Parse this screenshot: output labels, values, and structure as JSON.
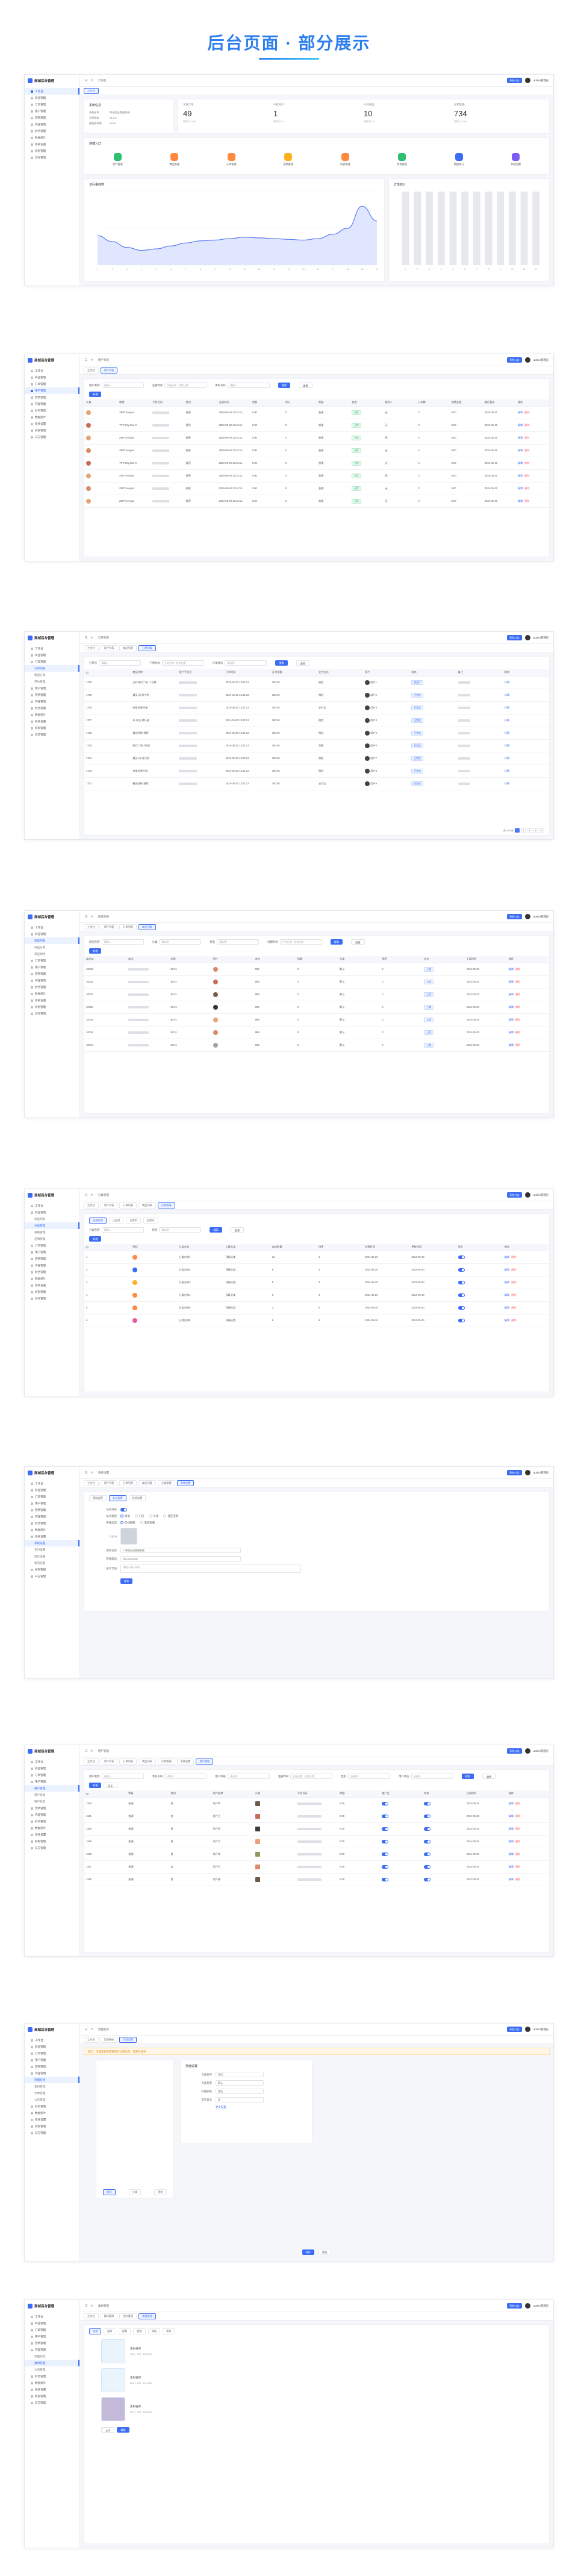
{
  "page": {
    "title": "后台页面 · 部分展示"
  },
  "app": {
    "name": "商城后台管理",
    "user": "admin管理员",
    "top_button": "系统公告"
  },
  "menu_main": [
    "工作台",
    "商品管理",
    "订单管理",
    "用户管理",
    "营销管理",
    "内容管理",
    "财务管理",
    "数据统计",
    "系统设置",
    "权限管理",
    "日志管理"
  ],
  "s1": {
    "crumb": "工作台",
    "tabs": [
      "工作台"
    ],
    "welcome_title": "系统信息",
    "info": [
      [
        "系统名称",
        "商城后台管理系统"
      ],
      [
        "当前版本",
        "v1.0.0"
      ],
      [
        "服务器系统",
        "Linux"
      ]
    ],
    "stats": [
      {
        "title": "今日订单",
        "value": "49",
        "sub": "较昨日 +8%"
      },
      {
        "title": "今日用户",
        "value": "1",
        "sub": "较昨日 +1"
      },
      {
        "title": "今日商品",
        "value": "10",
        "sub": "较昨日 +2"
      },
      {
        "title": "总销售额",
        "value": "734",
        "sub": "较昨日 +5%"
      }
    ],
    "quick_title": "快捷入口",
    "quick": [
      {
        "label": "用户管理",
        "color": "#2fbf71"
      },
      {
        "label": "商品管理",
        "color": "#ff8a3d"
      },
      {
        "label": "订单管理",
        "color": "#ff8a3d"
      },
      {
        "label": "营销管理",
        "color": "#ffb020"
      },
      {
        "label": "内容管理",
        "color": "#ff8a3d"
      },
      {
        "label": "财务管理",
        "color": "#2fbf71"
      },
      {
        "label": "数据统计",
        "color": "#3b6cf6"
      },
      {
        "label": "系统设置",
        "color": "#7b5cf6"
      }
    ],
    "chart_left_title": "访问量趋势",
    "chart_right_title": "订单统计"
  },
  "chart_data": [
    {
      "type": "area",
      "title": "访问量趋势",
      "x": [
        "1",
        "2",
        "3",
        "4",
        "5",
        "6",
        "7",
        "8",
        "9",
        "10",
        "11",
        "12",
        "13",
        "14",
        "15",
        "16",
        "17",
        "18",
        "19",
        "20"
      ],
      "series": [
        {
          "values": [
            40,
            32,
            24,
            20,
            22,
            26,
            30,
            33,
            34,
            36,
            38,
            37,
            36,
            35,
            34,
            36,
            42,
            50,
            80,
            60
          ]
        }
      ],
      "ylim": [
        0,
        100
      ],
      "color": "#5b7cf6"
    },
    {
      "type": "bar",
      "title": "订单统计",
      "categories": [
        "1",
        "2",
        "3",
        "4",
        "5",
        "6",
        "7",
        "8",
        "9",
        "10",
        "11",
        "12"
      ],
      "values": [
        100,
        100,
        100,
        100,
        100,
        100,
        100,
        100,
        100,
        100,
        100,
        100
      ],
      "ylim": [
        0,
        100
      ],
      "color": "#e6e8ec"
    }
  ],
  "s2": {
    "crumb": "用户列表",
    "tabs": [
      "工作台",
      "用户列表"
    ],
    "filters": [
      [
        "用户昵称",
        "请输入"
      ],
      [
        "注册时间",
        "开始日期 - 结束日期"
      ],
      [
        "手机号码",
        "请输入"
      ]
    ],
    "search": "搜索",
    "reset": "重置",
    "add": "新增",
    "columns": [
      "头像",
      "昵称",
      "手机号码",
      "性别",
      "注册时间",
      "余额",
      "积分",
      "等级",
      "状态",
      "推荐人",
      "订单数",
      "消费金额",
      "最后登录",
      "操作"
    ],
    "rows": [
      {
        "nick": "ZBPTAeeyaa",
        "sex": "保密",
        "time": "2024-05-20 13:42:12",
        "balance": "0.00",
        "points": "0",
        "level": "普通",
        "status": "正常",
        "ref": "无",
        "orders": "0",
        "spend": "0.00",
        "last": "2024-05-20",
        "av": "#e8a27a"
      },
      {
        "nick": "TP·Party.Nan·0",
        "sex": "保密",
        "time": "2024-05-20 13:42:12",
        "balance": "0.00",
        "points": "0",
        "level": "普通",
        "status": "正常",
        "ref": "无",
        "orders": "0",
        "spend": "0.00",
        "last": "2024-05-20",
        "av": "#c96b5a"
      },
      {
        "nick": "ZBPTAeeyaa",
        "sex": "保密",
        "time": "2024-05-20 13:42:12",
        "balance": "0.00",
        "points": "0",
        "level": "普通",
        "status": "正常",
        "ref": "无",
        "orders": "0",
        "spend": "0.00",
        "last": "2024-05-20",
        "av": "#e8a27a"
      },
      {
        "nick": "ZBPTAeeyaa",
        "sex": "保密",
        "time": "2024-05-20 13:42:12",
        "balance": "0.00",
        "points": "0",
        "level": "普通",
        "status": "正常",
        "ref": "无",
        "orders": "0",
        "spend": "0.00",
        "last": "2024-05-20",
        "av": "#d98c6a"
      },
      {
        "nick": "TP·Party.Nan·0",
        "sex": "保密",
        "time": "2024-05-20 13:42:12",
        "balance": "0.00",
        "points": "0",
        "level": "普通",
        "status": "正常",
        "ref": "无",
        "orders": "0",
        "spend": "0.00",
        "last": "2024-05-20",
        "av": "#c96b5a"
      },
      {
        "nick": "ZBPTAeeyaa",
        "sex": "保密",
        "time": "2024-05-20 13:42:12",
        "balance": "0.00",
        "points": "0",
        "level": "普通",
        "status": "正常",
        "ref": "无",
        "orders": "0",
        "spend": "0.00",
        "last": "2024-05-20",
        "av": "#e8a27a"
      },
      {
        "nick": "ZBPTAeeyaa",
        "sex": "保密",
        "time": "2024-05-20 13:42:12",
        "balance": "0.00",
        "points": "0",
        "level": "普通",
        "status": "正常",
        "ref": "无",
        "orders": "0",
        "spend": "0.00",
        "last": "2024-05-20",
        "av": "#d98c6a"
      },
      {
        "nick": "ZBPTAeeyaa",
        "sex": "保密",
        "time": "2024-05-20 13:42:12",
        "balance": "0.00",
        "points": "0",
        "level": "普通",
        "status": "正常",
        "ref": "无",
        "orders": "0",
        "spend": "0.00",
        "last": "2024-05-20",
        "av": "#e8a27a"
      }
    ],
    "op_edit": "编辑",
    "op_del": "删除"
  },
  "s3": {
    "crumb": "订单列表",
    "tabs": [
      "工作台",
      "用户列表",
      "商品列表",
      "订单列表"
    ],
    "filters": [
      [
        "订单号",
        "请输入"
      ],
      [
        "下单时间",
        "开始日期 - 结束日期"
      ],
      [
        "订单状态",
        "请选择"
      ]
    ],
    "search": "搜索",
    "reset": "重置",
    "columns": [
      "ID",
      "商品名称",
      "用户手机号",
      "下单时间",
      "订单金额",
      "支付方式",
      "用户",
      "状态",
      "备注",
      "操作"
    ],
    "rows": [
      {
        "id": "1710",
        "name": "万科时代广场 · 2号楼",
        "time": "2024-05-20 13:42:12",
        "amount": "180.00",
        "pay": "微信",
        "user": "用户1",
        "status": "待支付"
      },
      {
        "id": "1709",
        "name": "遇见·风·时光的",
        "time": "2024-05-20 13:42:12",
        "amount": "180.00",
        "pay": "微信",
        "user": "用户2",
        "status": "已完成"
      },
      {
        "id": "1708",
        "name": "亲爱的旅行者",
        "time": "2024-05-20 13:42:12",
        "amount": "180.00",
        "pay": "支付宝",
        "user": "用户3",
        "status": "已完成"
      },
      {
        "id": "1707",
        "name": "风·时光·旅行者",
        "time": "2024-05-20 13:42:12",
        "amount": "180.00",
        "pay": "微信",
        "user": "用户4",
        "status": "已完成"
      },
      {
        "id": "1706",
        "name": "精选好物·推荐",
        "time": "2024-05-20 13:42:12",
        "amount": "180.00",
        "pay": "微信",
        "user": "用户5",
        "status": "已完成"
      },
      {
        "id": "1705",
        "name": "时代广场·3号楼",
        "time": "2024-05-20 13:42:12",
        "amount": "180.00",
        "pay": "余额",
        "user": "用户6",
        "status": "已完成"
      },
      {
        "id": "1704",
        "name": "遇见·风·时光的",
        "time": "2024-05-20 13:42:12",
        "amount": "180.00",
        "pay": "微信",
        "user": "用户7",
        "status": "已完成"
      },
      {
        "id": "1703",
        "name": "亲爱的旅行者",
        "time": "2024-05-20 13:42:12",
        "amount": "180.00",
        "pay": "微信",
        "user": "用户8",
        "status": "已完成"
      },
      {
        "id": "1702",
        "name": "精选好物·推荐",
        "time": "2024-05-20 13:42:12",
        "amount": "180.00",
        "pay": "支付宝",
        "user": "用户9",
        "status": "已完成"
      }
    ],
    "op": "详情",
    "total": "共 100 条",
    "pages": [
      "1",
      "2",
      "3",
      "4",
      "5"
    ]
  },
  "s4": {
    "crumb": "商品列表",
    "tabs": [
      "工作台",
      "用户列表",
      "订单列表",
      "商品列表"
    ],
    "filters": [
      [
        "商品名称",
        "请输入"
      ],
      [
        "分类",
        "请选择"
      ],
      [
        "状态",
        "请选择"
      ],
      [
        "创建时间",
        "开始日期 - 结束日期"
      ]
    ],
    "search": "搜索",
    "reset": "重置",
    "add": "新增",
    "columns": [
      "商品ID",
      "商品",
      "价格",
      "图片",
      "库存",
      "销量",
      "分类",
      "排序",
      "状态",
      "上架时间",
      "操作"
    ],
    "rows": [
      {
        "id": "10023",
        "price": "¥0.01",
        "stock": "999",
        "sales": "0",
        "cat": "默认",
        "sort": "0",
        "status": "上架",
        "time": "2024-05-20",
        "av": "#d98c6a"
      },
      {
        "id": "10022",
        "price": "¥0.01",
        "stock": "999",
        "sales": "0",
        "cat": "默认",
        "sort": "0",
        "status": "上架",
        "time": "2024-05-20",
        "av": "#c96b5a"
      },
      {
        "id": "10021",
        "price": "¥0.01",
        "stock": "999",
        "sales": "0",
        "cat": "默认",
        "sort": "0",
        "status": "上架",
        "time": "2024-05-20",
        "av": "#7a5a4a"
      },
      {
        "id": "10020",
        "price": "¥0.01",
        "stock": "999",
        "sales": "0",
        "cat": "默认",
        "sort": "0",
        "status": "上架",
        "time": "2024-05-20",
        "av": "#333333"
      },
      {
        "id": "10019",
        "price": "¥0.01",
        "stock": "999",
        "sales": "0",
        "cat": "默认",
        "sort": "0",
        "status": "上架",
        "time": "2024-05-20",
        "av": "#e8a27a"
      },
      {
        "id": "10018",
        "price": "¥0.01",
        "stock": "999",
        "sales": "0",
        "cat": "默认",
        "sort": "0",
        "status": "上架",
        "time": "2024-05-20",
        "av": "#d98c6a"
      },
      {
        "id": "10017",
        "price": "¥0.01",
        "stock": "999",
        "sales": "0",
        "cat": "默认",
        "sort": "0",
        "status": "上架",
        "time": "2024-05-20",
        "av": "#a0a4ad"
      }
    ],
    "op_edit": "编辑",
    "op_del": "删除"
  },
  "s5": {
    "crumb": "分类管理",
    "tabs": [
      "工作台",
      "用户列表",
      "订单列表",
      "商品列表",
      "分类管理"
    ],
    "subtabs": [
      "全部分类",
      "已启用",
      "已禁用",
      "回收站"
    ],
    "filters": [
      [
        "分类名称",
        "请输入"
      ],
      [
        "状态",
        "请选择"
      ]
    ],
    "search": "搜索",
    "reset": "重置",
    "add": "新增",
    "columns": [
      "ID",
      "图标",
      "分类名称",
      "上级分类",
      "商品数量",
      "排序",
      "创建时间",
      "更新时间",
      "显示",
      "操作"
    ],
    "rows": [
      {
        "id": "1",
        "name": "分类名称1",
        "parent": "顶级分类",
        "count": "12",
        "sort": "1",
        "time": "2024-05-20",
        "color": "#ff8a3d"
      },
      {
        "id": "2",
        "name": "分类名称2",
        "parent": "顶级分类",
        "count": "8",
        "sort": "2",
        "time": "2024-05-20",
        "color": "#3b6cf6"
      },
      {
        "id": "3",
        "name": "分类名称3",
        "parent": "顶级分类",
        "count": "5",
        "sort": "3",
        "time": "2024-05-20",
        "color": "#ffb020"
      },
      {
        "id": "4",
        "name": "分类名称4",
        "parent": "顶级分类",
        "count": "9",
        "sort": "4",
        "time": "2024-05-20",
        "color": "#ff8a3d"
      },
      {
        "id": "5",
        "name": "分类名称5",
        "parent": "顶级分类",
        "count": "3",
        "sort": "5",
        "time": "2024-05-20",
        "color": "#ff8a3d"
      },
      {
        "id": "6",
        "name": "分类名称6",
        "parent": "顶级分类",
        "count": "6",
        "sort": "6",
        "time": "2024-05-20",
        "color": "#e65aa0"
      }
    ],
    "op_edit": "编辑",
    "op_del": "删除"
  },
  "s6": {
    "crumb": "系统设置",
    "tabs": [
      "工作台",
      "用户列表",
      "订单列表",
      "商品列表",
      "分类管理",
      "系统设置"
    ],
    "subtabs": [
      "基础设置",
      "支付设置",
      "短信设置"
    ],
    "fields": [
      {
        "label": "站点开关",
        "type": "switch"
      },
      {
        "label": "站点类型",
        "type": "radio",
        "options": [
          "商城",
          "门店",
          "外卖",
          "社区团购"
        ]
      },
      {
        "label": "客服类型",
        "type": "radio",
        "options": [
          "在线客服",
          "电话客服"
        ]
      },
      {
        "label": "LOGO",
        "type": "image"
      },
      {
        "label": "版权信息",
        "type": "text",
        "value": "© 商城后台管理系统"
      },
      {
        "label": "客服电话",
        "type": "text",
        "value": "400-000-0000"
      },
      {
        "label": "统计代码",
        "type": "textarea",
        "value": "请输入统计代码"
      }
    ],
    "submit": "保存"
  },
  "s7": {
    "crumb": "用户管理",
    "tabs": [
      "工作台",
      "用户列表",
      "订单列表",
      "商品列表",
      "分类管理",
      "系统设置",
      "用户管理"
    ],
    "filters": [
      [
        "用户昵称",
        "请输入"
      ],
      [
        "手机号码",
        "请输入"
      ],
      [
        "用户等级",
        "请选择"
      ],
      [
        "注册时间",
        "开始日期 - 结束日期"
      ],
      [
        "性别",
        "请选择"
      ],
      [
        "用户状态",
        "请选择"
      ]
    ],
    "search": "搜索",
    "reset": "重置",
    "actions": [
      "新增",
      "导出"
    ],
    "columns": [
      "ID",
      "等级",
      "性别",
      "用户昵称",
      "头像",
      "手机号码",
      "余额",
      "推广员",
      "状态",
      "注册时间",
      "操作"
    ],
    "rows": [
      {
        "id": "1162",
        "level": "普通",
        "sex": "男",
        "nick": "用户甲",
        "bal": "0.00",
        "time": "2024-05-20",
        "av": "#6b5a4a"
      },
      {
        "id": "1161",
        "level": "普通",
        "sex": "女",
        "nick": "用户乙",
        "bal": "0.00",
        "time": "2024-05-20",
        "av": "#c96b5a"
      },
      {
        "id": "1160",
        "level": "普通",
        "sex": "男",
        "nick": "用户丙",
        "bal": "0.00",
        "time": "2024-05-20",
        "av": "#3c3c3c"
      },
      {
        "id": "1159",
        "level": "普通",
        "sex": "男",
        "nick": "用户丁",
        "bal": "0.00",
        "time": "2024-05-20",
        "av": "#e8a27a"
      },
      {
        "id": "1158",
        "level": "普通",
        "sex": "男",
        "nick": "用户戊",
        "bal": "0.00",
        "time": "2024-05-20",
        "av": "#8a9a5a"
      },
      {
        "id": "1157",
        "level": "普通",
        "sex": "女",
        "nick": "用户己",
        "bal": "0.00",
        "time": "2024-05-20",
        "av": "#d98c6a"
      },
      {
        "id": "1156",
        "level": "普通",
        "sex": "男",
        "nick": "用户庚",
        "bal": "0.00",
        "time": "2024-05-20",
        "av": "#6b5a4a"
      }
    ],
    "op_edit": "编辑",
    "op_del": "删除"
  },
  "s8": {
    "crumb": "页面装修",
    "tabs": [
      "工作台",
      "页面装修",
      "页面设置"
    ],
    "notice": "提示：页面装修后需要保存才能生效，请及时保存",
    "panel_title": "页面设置",
    "props": [
      [
        "页面名称",
        "首页"
      ],
      [
        "页面背景",
        "默认"
      ],
      [
        "标题颜色",
        "黑色"
      ],
      [
        "是否显示",
        "是"
      ]
    ],
    "more": "更多设置",
    "buttons": [
      "保存",
      "预览"
    ],
    "phone_tabs": [
      "首页",
      "分类",
      "我的"
    ]
  },
  "s9": {
    "crumb": "素材管理",
    "tabs": [
      "工作台",
      "素材管理",
      "图片管理",
      "素材管理"
    ],
    "subtabs": [
      "全部",
      "图片",
      "视频",
      "音频",
      "文档",
      "其他"
    ],
    "items": [
      {
        "label": "素材名称",
        "meta": "200 × 200  ·  12.5 KB"
      },
      {
        "label": "素材名称",
        "meta": "200 × 200  ·  10.1 KB"
      },
      {
        "label": "素材名称",
        "meta": "200 × 200  ·  18.3 KB"
      }
    ],
    "upload": "上传",
    "submit": "确定"
  }
}
